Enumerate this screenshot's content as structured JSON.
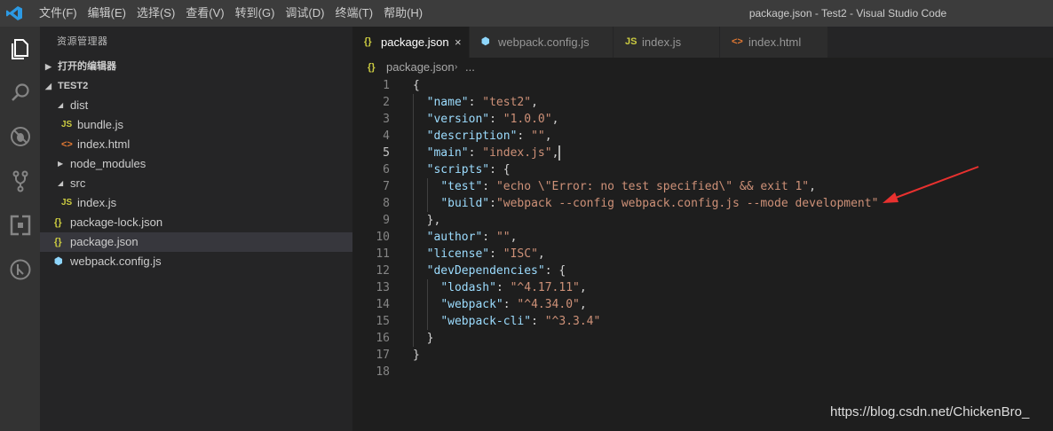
{
  "titlebar": {
    "menu": [
      "文件(F)",
      "编辑(E)",
      "选择(S)",
      "查看(V)",
      "转到(G)",
      "调试(D)",
      "终端(T)",
      "帮助(H)"
    ],
    "window_title": "package.json - Test2 - Visual Studio Code"
  },
  "activitybar": {
    "icons": [
      "files-icon",
      "search-icon",
      "debug-icon",
      "source-control-icon",
      "extensions-icon",
      "remote-icon"
    ]
  },
  "sidebar": {
    "title": "资源管理器",
    "open_editors": "打开的编辑器",
    "project": "TEST2",
    "tree": [
      {
        "label": "dist",
        "kind": "folder",
        "depth": 1,
        "expanded": true
      },
      {
        "label": "bundle.js",
        "kind": "js",
        "depth": 2
      },
      {
        "label": "index.html",
        "kind": "html",
        "depth": 2
      },
      {
        "label": "node_modules",
        "kind": "folder",
        "depth": 1,
        "expanded": false
      },
      {
        "label": "src",
        "kind": "folder",
        "depth": 1,
        "expanded": true
      },
      {
        "label": "index.js",
        "kind": "js",
        "depth": 2
      },
      {
        "label": "package-lock.json",
        "kind": "json",
        "depth": 1
      },
      {
        "label": "package.json",
        "kind": "json",
        "depth": 1,
        "selected": true
      },
      {
        "label": "webpack.config.js",
        "kind": "webpack",
        "depth": 1
      }
    ],
    "icon_glyphs": {
      "js": "JS",
      "html": "<>",
      "json": "{}",
      "webpack": "⬢"
    }
  },
  "tabs": [
    {
      "label": "package.json",
      "icon": "{}",
      "kind": "json",
      "active": true,
      "close": "×"
    },
    {
      "label": "webpack.config.js",
      "icon": "⬢",
      "kind": "webpack"
    },
    {
      "label": "index.js",
      "icon": "JS",
      "kind": "js"
    },
    {
      "label": "index.html",
      "icon": "<>",
      "kind": "html"
    }
  ],
  "breadcrumb": {
    "icon": "{}",
    "file": "package.json",
    "sep": "›",
    "more": "..."
  },
  "editor": {
    "current_line": 5,
    "lines": [
      [
        [
          "p",
          "{"
        ]
      ],
      [
        [
          "p",
          "  "
        ],
        [
          "k",
          "\"name\""
        ],
        [
          "p",
          ": "
        ],
        [
          "s",
          "\"test2\""
        ],
        [
          "p",
          ","
        ]
      ],
      [
        [
          "p",
          "  "
        ],
        [
          "k",
          "\"version\""
        ],
        [
          "p",
          ": "
        ],
        [
          "s",
          "\"1.0.0\""
        ],
        [
          "p",
          ","
        ]
      ],
      [
        [
          "p",
          "  "
        ],
        [
          "k",
          "\"description\""
        ],
        [
          "p",
          ": "
        ],
        [
          "s",
          "\"\""
        ],
        [
          "p",
          ","
        ]
      ],
      [
        [
          "p",
          "  "
        ],
        [
          "k",
          "\"main\""
        ],
        [
          "p",
          ": "
        ],
        [
          "s",
          "\"index.js\""
        ],
        [
          "p",
          ","
        ]
      ],
      [
        [
          "p",
          "  "
        ],
        [
          "k",
          "\"scripts\""
        ],
        [
          "p",
          ": {"
        ]
      ],
      [
        [
          "p",
          "    "
        ],
        [
          "k",
          "\"test\""
        ],
        [
          "p",
          ": "
        ],
        [
          "s",
          "\"echo \\\"Error: no test specified\\\" && exit 1\""
        ],
        [
          "p",
          ","
        ]
      ],
      [
        [
          "p",
          "    "
        ],
        [
          "k",
          "\"build\""
        ],
        [
          "p",
          ":"
        ],
        [
          "s",
          "\"webpack --config webpack.config.js --mode development\""
        ]
      ],
      [
        [
          "p",
          "  },"
        ]
      ],
      [
        [
          "p",
          "  "
        ],
        [
          "k",
          "\"author\""
        ],
        [
          "p",
          ": "
        ],
        [
          "s",
          "\"\""
        ],
        [
          "p",
          ","
        ]
      ],
      [
        [
          "p",
          "  "
        ],
        [
          "k",
          "\"license\""
        ],
        [
          "p",
          ": "
        ],
        [
          "s",
          "\"ISC\""
        ],
        [
          "p",
          ","
        ]
      ],
      [
        [
          "p",
          "  "
        ],
        [
          "k",
          "\"devDependencies\""
        ],
        [
          "p",
          ": {"
        ]
      ],
      [
        [
          "p",
          "    "
        ],
        [
          "k",
          "\"lodash\""
        ],
        [
          "p",
          ": "
        ],
        [
          "s",
          "\"^4.17.11\""
        ],
        [
          "p",
          ","
        ]
      ],
      [
        [
          "p",
          "    "
        ],
        [
          "k",
          "\"webpack\""
        ],
        [
          "p",
          ": "
        ],
        [
          "s",
          "\"^4.34.0\""
        ],
        [
          "p",
          ","
        ]
      ],
      [
        [
          "p",
          "    "
        ],
        [
          "k",
          "\"webpack-cli\""
        ],
        [
          "p",
          ": "
        ],
        [
          "s",
          "\"^3.3.4\""
        ]
      ],
      [
        [
          "p",
          "  }"
        ]
      ],
      [
        [
          "p",
          "}"
        ]
      ],
      []
    ]
  },
  "colors": {
    "arrow": "#e8312f",
    "accent": "#007acc"
  },
  "watermark": "https://blog.csdn.net/ChickenBro_"
}
